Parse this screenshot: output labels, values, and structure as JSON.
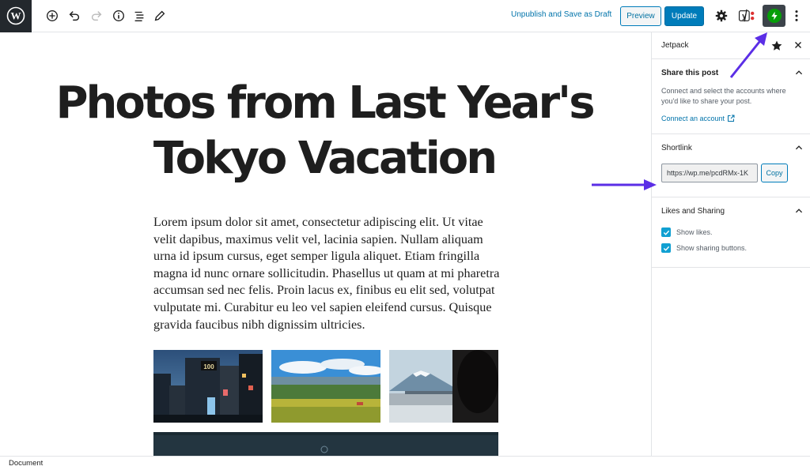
{
  "toolbar": {
    "unpublish_label": "Unpublish and Save as Draft",
    "preview_label": "Preview",
    "update_label": "Update",
    "icons": [
      "wordpress-logo",
      "add-block-icon",
      "undo-icon",
      "redo-icon",
      "info-icon",
      "outline-icon",
      "edit-tools-icon",
      "settings-icon",
      "yoast-icon",
      "jetpack-icon",
      "more-options-icon"
    ]
  },
  "sidebar": {
    "title": "Jetpack",
    "share_panel": {
      "title": "Share this post",
      "description": "Connect and select the accounts where you'd like to share your post.",
      "connect_label": "Connect an account"
    },
    "shortlink_panel": {
      "title": "Shortlink",
      "url": "https://wp.me/pcdRMx-1K",
      "copy_label": "Copy"
    },
    "likes_panel": {
      "title": "Likes and Sharing",
      "show_likes_label": "Show likes.",
      "show_sharing_label": "Show sharing buttons."
    }
  },
  "post": {
    "title": "Photos from Last Year's Tokyo Vacation",
    "body": "Lorem ipsum dolor sit amet, consectetur adipiscing elit. Ut vitae velit dapibus, maximus velit vel, lacinia sapien. Nullam aliquam urna id ipsum cursus, eget semper ligula aliquet. Etiam fringilla magna id nunc ornare sollicitudin. Phasellus ut quam at mi pharetra accumsan sed nec felis. Proin lacus ex, finibus eu elit sed, volutpat vulputate mi. Curabitur eu leo vel sapien eleifend cursus. Quisque gravida faucibus nibh dignissim ultricies.",
    "gallery_sign_text": "100"
  },
  "footer": {
    "breadcrumb": "Document"
  },
  "colors": {
    "accent": "#007cba",
    "jetpack_green": "#069e08",
    "annotation_arrow": "#5b2ee6"
  }
}
